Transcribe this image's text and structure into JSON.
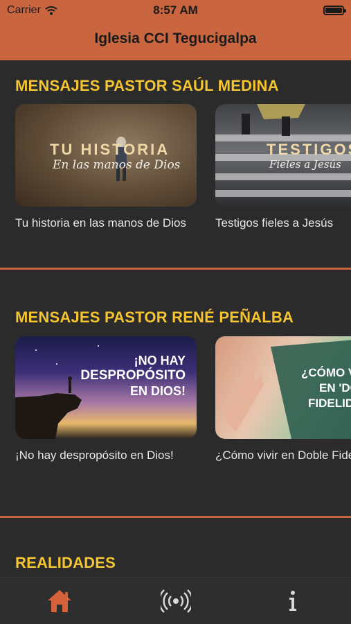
{
  "status_bar": {
    "carrier": "Carrier",
    "time": "8:57 AM"
  },
  "header": {
    "title": "Iglesia CCI Tegucigalpa"
  },
  "colors": {
    "accent": "#c9663f",
    "section_title": "#f5c431",
    "background": "#2b2b2b"
  },
  "sections": [
    {
      "title": "MENSAJES PASTOR SAÚL MEDINA",
      "cards": [
        {
          "caption": "Tu historia en las manos de Dios",
          "thumb_title": "TU HISTORIA",
          "thumb_subtitle": "En las manos de Dios"
        },
        {
          "caption": "Testigos fieles a Jesús",
          "thumb_title": "TESTIGOS",
          "thumb_subtitle": "Fieles a Jesús"
        }
      ]
    },
    {
      "title": "MENSAJES PASTOR RENÉ PEÑALBA",
      "cards": [
        {
          "caption": "¡No hay despropósito en Dios!",
          "thumb_line1": "¡NO HAY",
          "thumb_line2": "DESPROPÓSITO",
          "thumb_line3": "EN DIOS!"
        },
        {
          "caption": "¿Cómo vivir en Doble Fidelidad?",
          "thumb_line1": "¿CÓMO V",
          "thumb_line2": "EN 'DO",
          "thumb_line3": "FIDELIDA"
        }
      ]
    },
    {
      "title": "REALIDADES"
    }
  ],
  "tabbar": {
    "items": [
      {
        "icon": "home-icon",
        "active": true
      },
      {
        "icon": "radio-broadcast-icon"
      },
      {
        "icon": "info-icon"
      }
    ]
  }
}
